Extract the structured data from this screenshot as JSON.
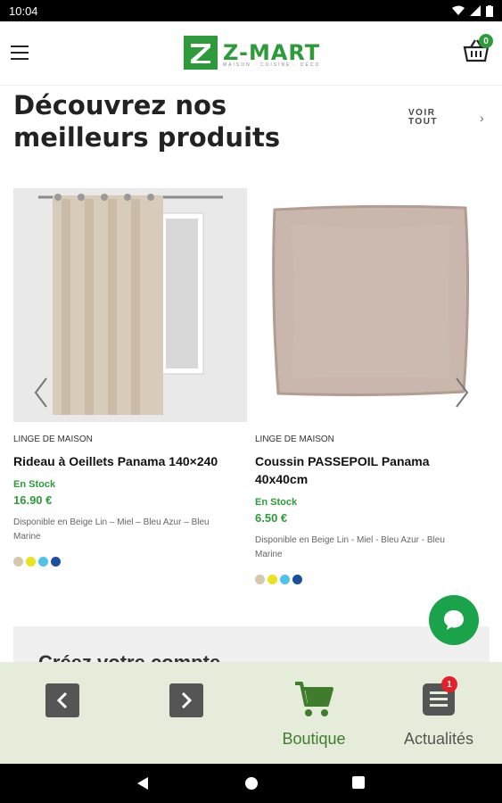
{
  "status_bar": {
    "time": "10:04"
  },
  "header": {
    "logo_text": "Z-MART",
    "logo_tagline": "MAISON · CUISINE · DÉCO",
    "cart_count": "0"
  },
  "section": {
    "title": "Découvrez nos meilleurs produits",
    "see_all_label": "VOIR TOUT"
  },
  "products": [
    {
      "category": "LINGE DE MAISON",
      "name": "Rideau à Oeillets Panama 140×240",
      "stock": "En Stock",
      "price": "16.90 €",
      "availability": "Disponible en Beige Lin – Miel – Bleu Azur – Bleu Marine",
      "swatches": [
        "#d6c7ae",
        "#e9e21f",
        "#4fc3e8",
        "#1c4f9c"
      ]
    },
    {
      "category": "LINGE DE MAISON",
      "name": "Coussin PASSEPOIL Panama 40x40cm",
      "stock": "En Stock",
      "price": "6.50 €",
      "availability": "Disponible en Beige Lin - Miel - Bleu Azur - Bleu Marine",
      "swatches": [
        "#d6c7ae",
        "#e9e21f",
        "#4fc3e8",
        "#1c4f9c"
      ]
    }
  ],
  "account_banner": {
    "text": "Créez votre compte"
  },
  "bottom_nav": {
    "boutique_label": "Boutique",
    "news_label": "Actualités",
    "news_badge": "1"
  },
  "colors": {
    "brand_green": "#2e9b3a",
    "tabbar_bg": "#e5ecd9",
    "badge_red": "#e4202a"
  }
}
